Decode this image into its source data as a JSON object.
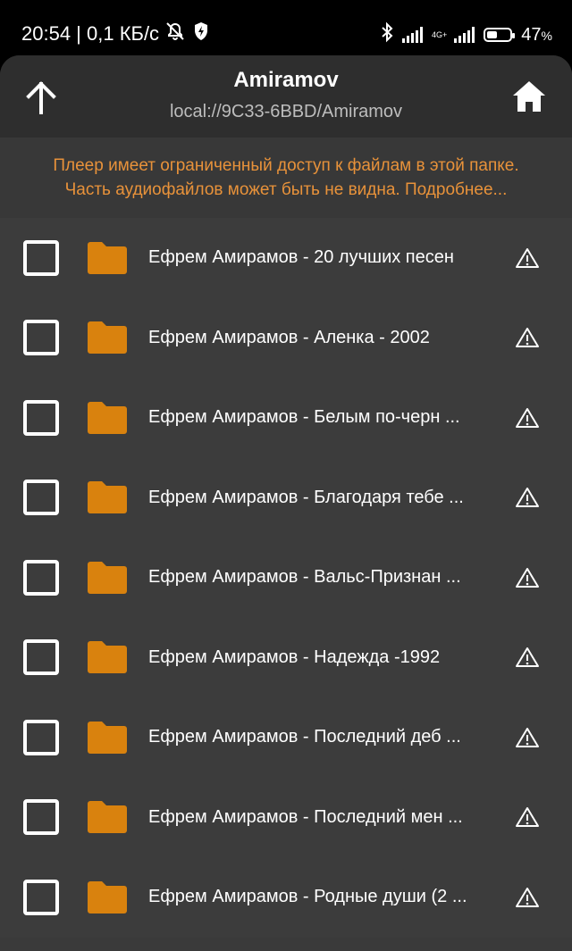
{
  "status_bar": {
    "time_and_speed": "20:54 | 0,1 КБ/с",
    "net_tag_top": "4G+",
    "battery_text": "47",
    "battery_unit": "%",
    "battery_level": 0.47
  },
  "header": {
    "title": "Amiramov",
    "path": "local://9C33-6BBD/Amiramov"
  },
  "notice": {
    "line1": "Плеер имеет ограниченный доступ к файлам в этой папке.",
    "line2": "Часть аудиофайлов может быть не видна. Подробнее..."
  },
  "folders": [
    {
      "name": "Ефрем Амирамов - 20 лучших песен"
    },
    {
      "name": "Ефрем Амирамов - Аленка - 2002"
    },
    {
      "name": "Ефрем Амирамов - Белым по-черн  ..."
    },
    {
      "name": "Ефрем Амирамов - Благодаря тебе  ..."
    },
    {
      "name": "Ефрем Амирамов - Вальс-Признан  ..."
    },
    {
      "name": "Ефрем Амирамов - Надежда -1992"
    },
    {
      "name": "Ефрем Амирамов - Последний деб  ..."
    },
    {
      "name": "Ефрем Амирамов - Последний мен  ..."
    },
    {
      "name": "Ефрем Амирамов - Родные души (2  ..."
    }
  ],
  "colors": {
    "folder": "#d9820e",
    "notice_text": "#e8923a",
    "background": "#3c3c3c"
  },
  "icons": {
    "up": "arrow-up-icon",
    "home": "home-icon",
    "folder": "folder-icon",
    "warning": "warning-icon"
  }
}
